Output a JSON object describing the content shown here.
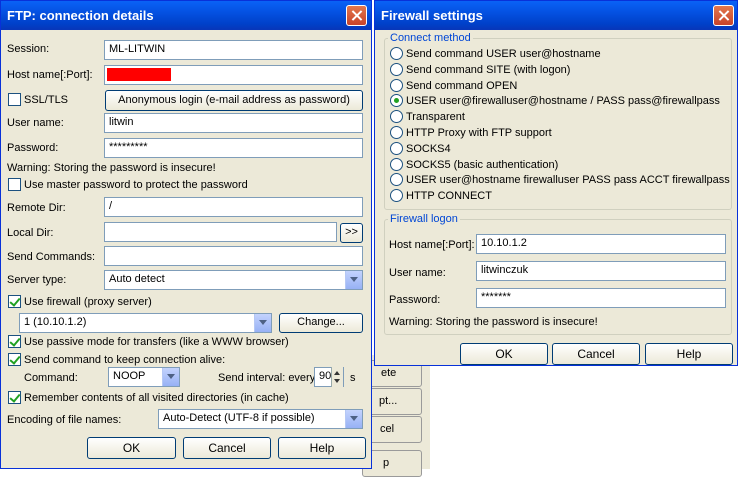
{
  "ftp": {
    "title": "FTP: connection details",
    "session_label": "Session:",
    "session_value": "ML-LITWIN",
    "host_label": "Host name[:Port]:",
    "host_value": "",
    "ssl_label": "SSL/TLS",
    "anon_button": "Anonymous login (e-mail address as password)",
    "user_label": "User name:",
    "user_value": "litwin",
    "password_label": "Password:",
    "password_value": "*********",
    "warning": "Warning: Storing the password is insecure!",
    "master_password_label": "Use master password to protect the password",
    "remote_dir_label": "Remote Dir:",
    "remote_dir_value": "/",
    "local_dir_label": "Local Dir:",
    "local_dir_value": "",
    "browse_button": ">>",
    "send_commands_label": "Send Commands:",
    "send_commands_value": "",
    "server_type_label": "Server type:",
    "server_type_value": "Auto detect",
    "use_firewall_label": "Use firewall (proxy server)",
    "firewall_value": "1 (10.10.1.2)",
    "change_button": "Change...",
    "passive_label": "Use passive mode for transfers (like a WWW browser)",
    "keepalive_label": "Send command to keep connection alive:",
    "command_label": "Command:",
    "command_value": "NOOP",
    "interval_label": "Send interval: every",
    "interval_value": "90",
    "interval_unit": "s",
    "remember_label": "Remember contents of all visited directories (in cache)",
    "encoding_label": "Encoding of file names:",
    "encoding_value": "Auto-Detect (UTF-8 if possible)",
    "ok": "OK",
    "cancel": "Cancel",
    "help": "Help",
    "checks": {
      "ssl": false,
      "master": false,
      "firewall": true,
      "passive": true,
      "keepalive": true,
      "remember": true
    }
  },
  "firewall": {
    "title": "Firewall settings",
    "connect_method_title": "Connect method",
    "methods": [
      "Send command USER user@hostname",
      "Send command SITE (with logon)",
      "Send command OPEN",
      "USER user@firewalluser@hostname / PASS pass@firewallpass",
      "Transparent",
      "HTTP Proxy with FTP support",
      "SOCKS4",
      "SOCKS5 (basic authentication)",
      "USER user@hostname firewalluser PASS pass ACCT firewallpass",
      "HTTP CONNECT"
    ],
    "selected_method_index": 3,
    "logon_title": "Firewall logon",
    "host_label": "Host name[:Port]:",
    "host_value": "10.10.1.2",
    "user_label": "User name:",
    "user_value": "litwinczuk",
    "password_label": "Password:",
    "password_value": "*******",
    "warning": "Warning: Storing the password is insecure!",
    "ok": "OK",
    "cancel": "Cancel",
    "help": "Help"
  },
  "background_buttons": [
    "ete",
    "pt...",
    "cel",
    "p"
  ]
}
